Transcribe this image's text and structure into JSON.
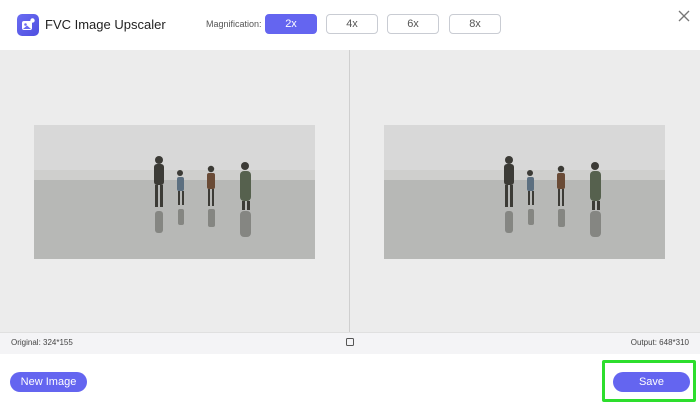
{
  "header": {
    "app_title": "FVC Image Upscaler",
    "magnification_label": "Magnification:",
    "magnification_options": [
      "2x",
      "4x",
      "6x",
      "8x"
    ],
    "selected_magnification": "2x"
  },
  "info_bar": {
    "original": "Original: 324*155",
    "output": "Output: 648*310"
  },
  "footer": {
    "new_image_label": "New Image",
    "save_label": "Save"
  },
  "colors": {
    "accent": "#6465f0",
    "highlight": "#2dde2d"
  },
  "icons": [
    "app-logo-icon",
    "close-icon",
    "compare-icon"
  ]
}
